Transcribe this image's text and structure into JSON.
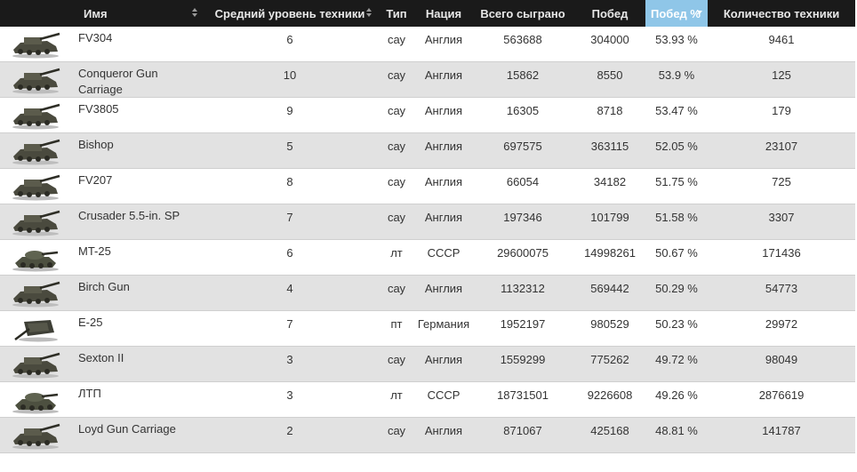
{
  "header": {
    "columns": [
      {
        "label": "Имя",
        "name": "col-name",
        "sort": "both"
      },
      {
        "label": "Средний уровень техники",
        "name": "col-tier",
        "sort": "both"
      },
      {
        "label": "Тип",
        "name": "col-type",
        "sort": "none"
      },
      {
        "label": "Нация",
        "name": "col-nation",
        "sort": "none"
      },
      {
        "label": "Всего сыграно",
        "name": "col-total",
        "sort": "none"
      },
      {
        "label": "Побед",
        "name": "col-wins",
        "sort": "none"
      },
      {
        "label": "Побед %",
        "name": "col-winrate",
        "sort": "desc"
      },
      {
        "label": "Количество техники",
        "name": "col-count",
        "sort": "none"
      }
    ],
    "active_color": "#8fc6e8"
  },
  "rows": [
    {
      "name": "FV304",
      "tier": "6",
      "type": "сау",
      "nation": "Англия",
      "total": "563688",
      "wins": "304000",
      "winrate": "53.93 %",
      "count": "9461",
      "icon": "spg-icon"
    },
    {
      "name": "Conqueror Gun Carriage",
      "tier": "10",
      "type": "сау",
      "nation": "Англия",
      "total": "15862",
      "wins": "8550",
      "winrate": "53.9 %",
      "count": "125",
      "icon": "spg-icon"
    },
    {
      "name": "FV3805",
      "tier": "9",
      "type": "сау",
      "nation": "Англия",
      "total": "16305",
      "wins": "8718",
      "winrate": "53.47 %",
      "count": "179",
      "icon": "spg-icon"
    },
    {
      "name": "Bishop",
      "tier": "5",
      "type": "сау",
      "nation": "Англия",
      "total": "697575",
      "wins": "363115",
      "winrate": "52.05 %",
      "count": "23107",
      "icon": "spg-icon"
    },
    {
      "name": "FV207",
      "tier": "8",
      "type": "сау",
      "nation": "Англия",
      "total": "66054",
      "wins": "34182",
      "winrate": "51.75 %",
      "count": "725",
      "icon": "spg-icon"
    },
    {
      "name": "Crusader 5.5-in. SP",
      "tier": "7",
      "type": "сау",
      "nation": "Англия",
      "total": "197346",
      "wins": "101799",
      "winrate": "51.58 %",
      "count": "3307",
      "icon": "spg-icon"
    },
    {
      "name": "MT-25",
      "tier": "6",
      "type": "лт",
      "nation": "СССР",
      "total": "29600075",
      "wins": "14998261",
      "winrate": "50.67 %",
      "count": "171436",
      "icon": "light-tank-icon"
    },
    {
      "name": "Birch Gun",
      "tier": "4",
      "type": "сау",
      "nation": "Англия",
      "total": "1132312",
      "wins": "569442",
      "winrate": "50.29 %",
      "count": "54773",
      "icon": "spg-icon"
    },
    {
      "name": "E-25",
      "tier": "7",
      "type": "пт",
      "nation": "Германия",
      "total": "1952197",
      "wins": "980529",
      "winrate": "50.23 %",
      "count": "29972",
      "icon": "tank-destroyer-icon"
    },
    {
      "name": "Sexton II",
      "tier": "3",
      "type": "сау",
      "nation": "Англия",
      "total": "1559299",
      "wins": "775262",
      "winrate": "49.72 %",
      "count": "98049",
      "icon": "spg-icon"
    },
    {
      "name": "ЛТП",
      "tier": "3",
      "type": "лт",
      "nation": "СССР",
      "total": "18731501",
      "wins": "9226608",
      "winrate": "49.26 %",
      "count": "2876619",
      "icon": "light-tank-icon"
    },
    {
      "name": "Loyd Gun Carriage",
      "tier": "2",
      "type": "сау",
      "nation": "Англия",
      "total": "871067",
      "wins": "425168",
      "winrate": "48.81 %",
      "count": "141787",
      "icon": "spg-icon"
    }
  ]
}
